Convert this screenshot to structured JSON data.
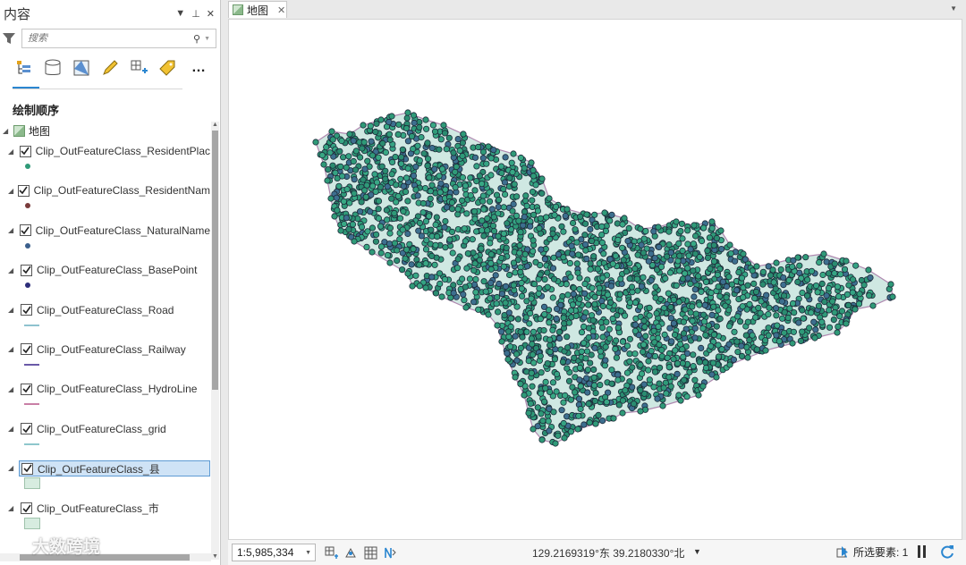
{
  "pane": {
    "title": "内容",
    "search_placeholder": "搜索",
    "section_title": "绘制顺序",
    "map_label": "地图",
    "layers": [
      {
        "name": "Clip_OutFeatureClass_ResidentPlac",
        "symbol": "point",
        "color": "#2f9a78"
      },
      {
        "name": "Clip_OutFeatureClass_ResidentNam",
        "symbol": "point",
        "color": "#7a3b3b"
      },
      {
        "name": "Clip_OutFeatureClass_NaturalName",
        "symbol": "point",
        "color": "#3b5f8c"
      },
      {
        "name": "Clip_OutFeatureClass_BasePoint",
        "symbol": "point",
        "color": "#2d2e7a"
      },
      {
        "name": "Clip_OutFeatureClass_Road",
        "symbol": "line",
        "color": "#8ec3cf"
      },
      {
        "name": "Clip_OutFeatureClass_Railway",
        "symbol": "line",
        "color": "#6a5aa8"
      },
      {
        "name": "Clip_OutFeatureClass_HydroLine",
        "symbol": "line",
        "color": "#c97fa6"
      },
      {
        "name": "Clip_OutFeatureClass_grid",
        "symbol": "line",
        "color": "#8ec7cc"
      },
      {
        "name": "Clip_OutFeatureClass_县",
        "symbol": "polygon",
        "color": "#d7ece0",
        "selected": true
      },
      {
        "name": "Clip_OutFeatureClass_市",
        "symbol": "polygon",
        "color": "#d7ece0"
      }
    ]
  },
  "tab": {
    "label": "地图"
  },
  "status": {
    "scale": "1:5,985,334",
    "coordinates": "129.2169319°东 39.2180330°北",
    "selected_features": "所选要素: 1"
  },
  "watermark": "大数跨境",
  "colors": {
    "accent": "#2a86d0",
    "point_fill": "#2f9a78",
    "point_outline": "#1d2b3a",
    "region_fill": "#cfe8e2"
  }
}
